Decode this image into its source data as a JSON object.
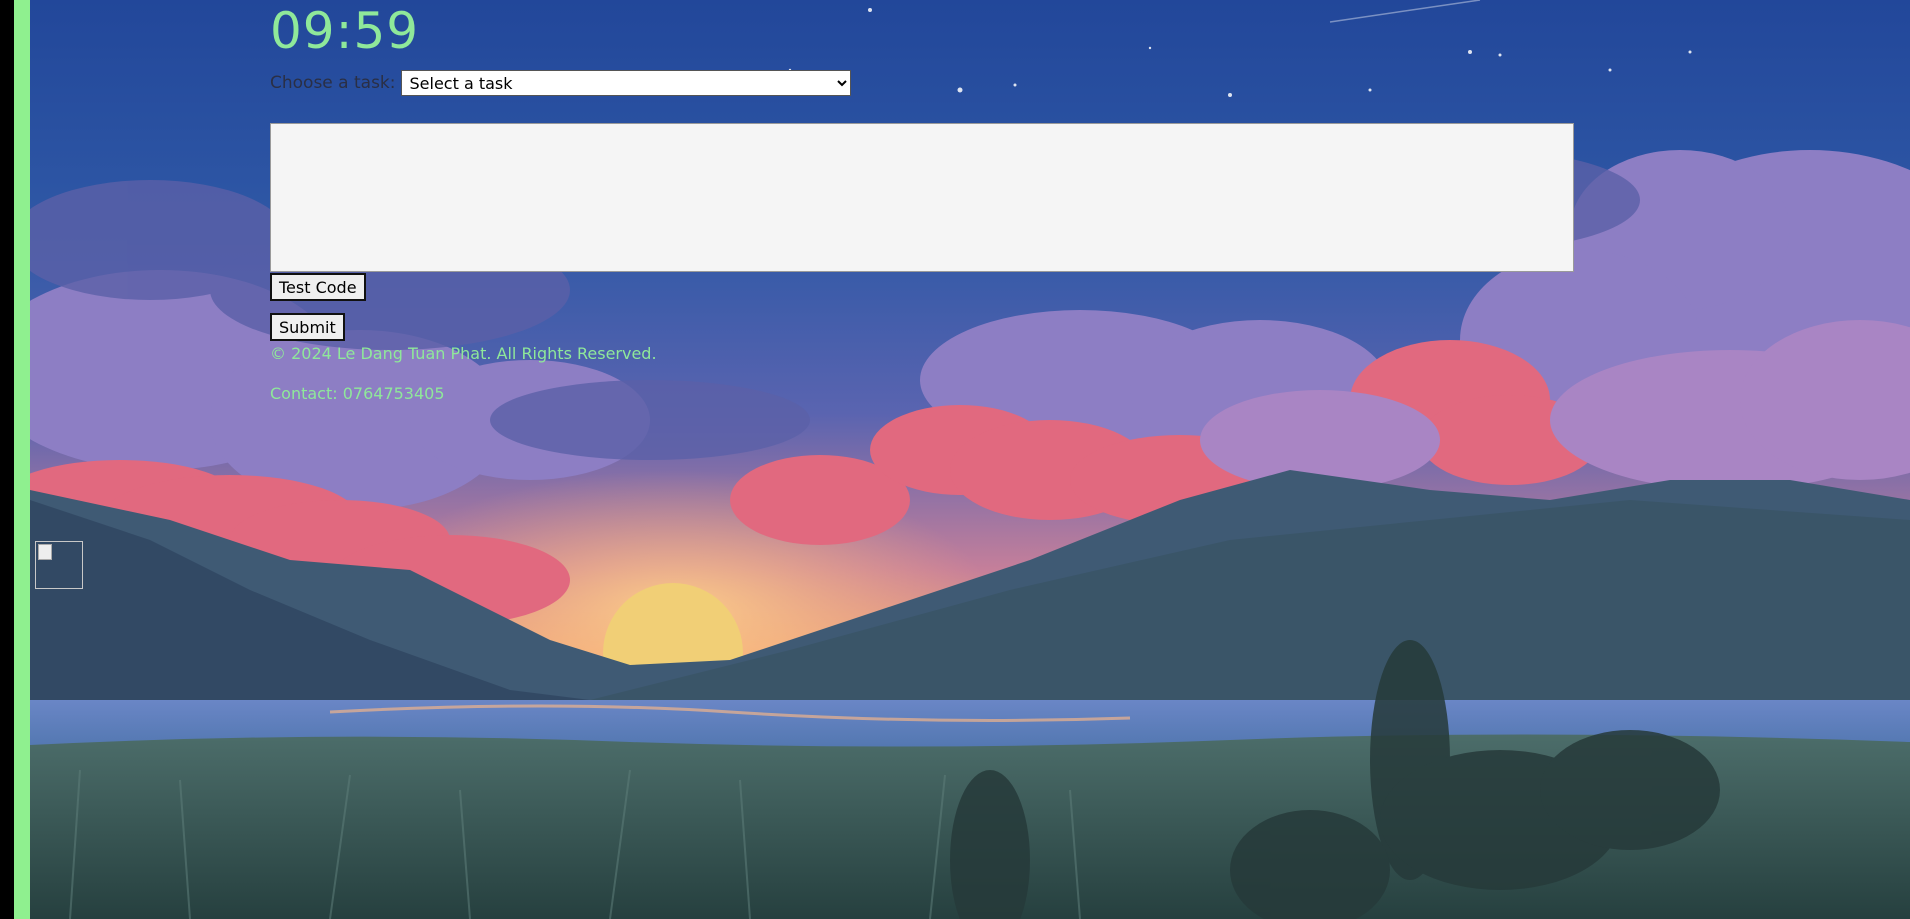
{
  "clock": {
    "time": "09:59"
  },
  "task_picker": {
    "label": "Choose a task:",
    "selected": "Select a task",
    "options": [
      "Select a task"
    ]
  },
  "editor": {
    "value": ""
  },
  "buttons": {
    "test_code": "Test Code",
    "submit": "Submit"
  },
  "footer": {
    "copyright": "© 2024 Le Dang Tuan Phat. All Rights Reserved.",
    "contact": "Contact: 0764753405"
  },
  "colors": {
    "accent_green": "#8fe89a",
    "strip_green": "#8ff08f",
    "sky_top": "#234a9c",
    "cloud_pink": "#e0697e",
    "cloud_purple": "#9b84c4",
    "sun": "#f1cf76",
    "grass": "#3f5f5b"
  },
  "icons": {
    "broken_image": "broken-image-icon"
  }
}
